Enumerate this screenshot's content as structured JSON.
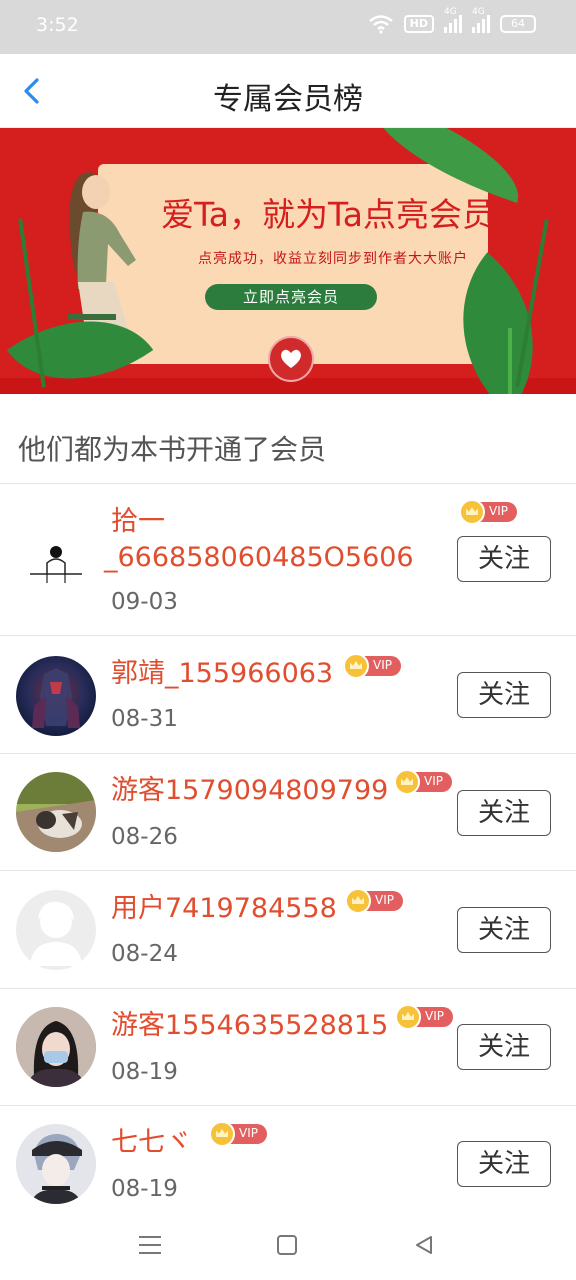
{
  "status_bar": {
    "time": "3:52",
    "hd_label": "HD",
    "signal1_label": "4G",
    "signal2_label": "4G",
    "battery": "64"
  },
  "header": {
    "title": "专属会员榜",
    "back_icon": "chevron-left-icon",
    "accent_color": "#2a8cf0"
  },
  "banner": {
    "heading": "爱Ta，就为Ta点亮会员",
    "subtitle": "点亮成功，收益立刻同步到作者大大账户",
    "button_label": "立即点亮会员"
  },
  "section": {
    "title": "他们都为本书开通了会员"
  },
  "members": [
    {
      "name": "拾一_666858060485O5606",
      "date": "09-03",
      "vip_label": "VIP",
      "follow_label": "关注"
    },
    {
      "name": "郭靖_155966063",
      "date": "08-31",
      "vip_label": "VIP",
      "follow_label": "关注"
    },
    {
      "name": "游客1579094809799",
      "date": "08-26",
      "vip_label": "VIP",
      "follow_label": "关注"
    },
    {
      "name": "用户7419784558",
      "date": "08-24",
      "vip_label": "VIP",
      "follow_label": "关注"
    },
    {
      "name": "游客1554635528815",
      "date": "08-19",
      "vip_label": "VIP",
      "follow_label": "关注"
    },
    {
      "name": "七七ヾ",
      "date": "08-19",
      "vip_label": "VIP",
      "follow_label": "关注"
    }
  ],
  "nav_bar": {
    "menu_icon": "menu-icon",
    "home_icon": "home-icon",
    "back_icon": "back-triangle-icon"
  },
  "colors": {
    "name_color": "#e04e2f",
    "banner_red": "#d51e1e",
    "vip_red": "#e35f5f",
    "crown_gold": "#f7c23a"
  }
}
